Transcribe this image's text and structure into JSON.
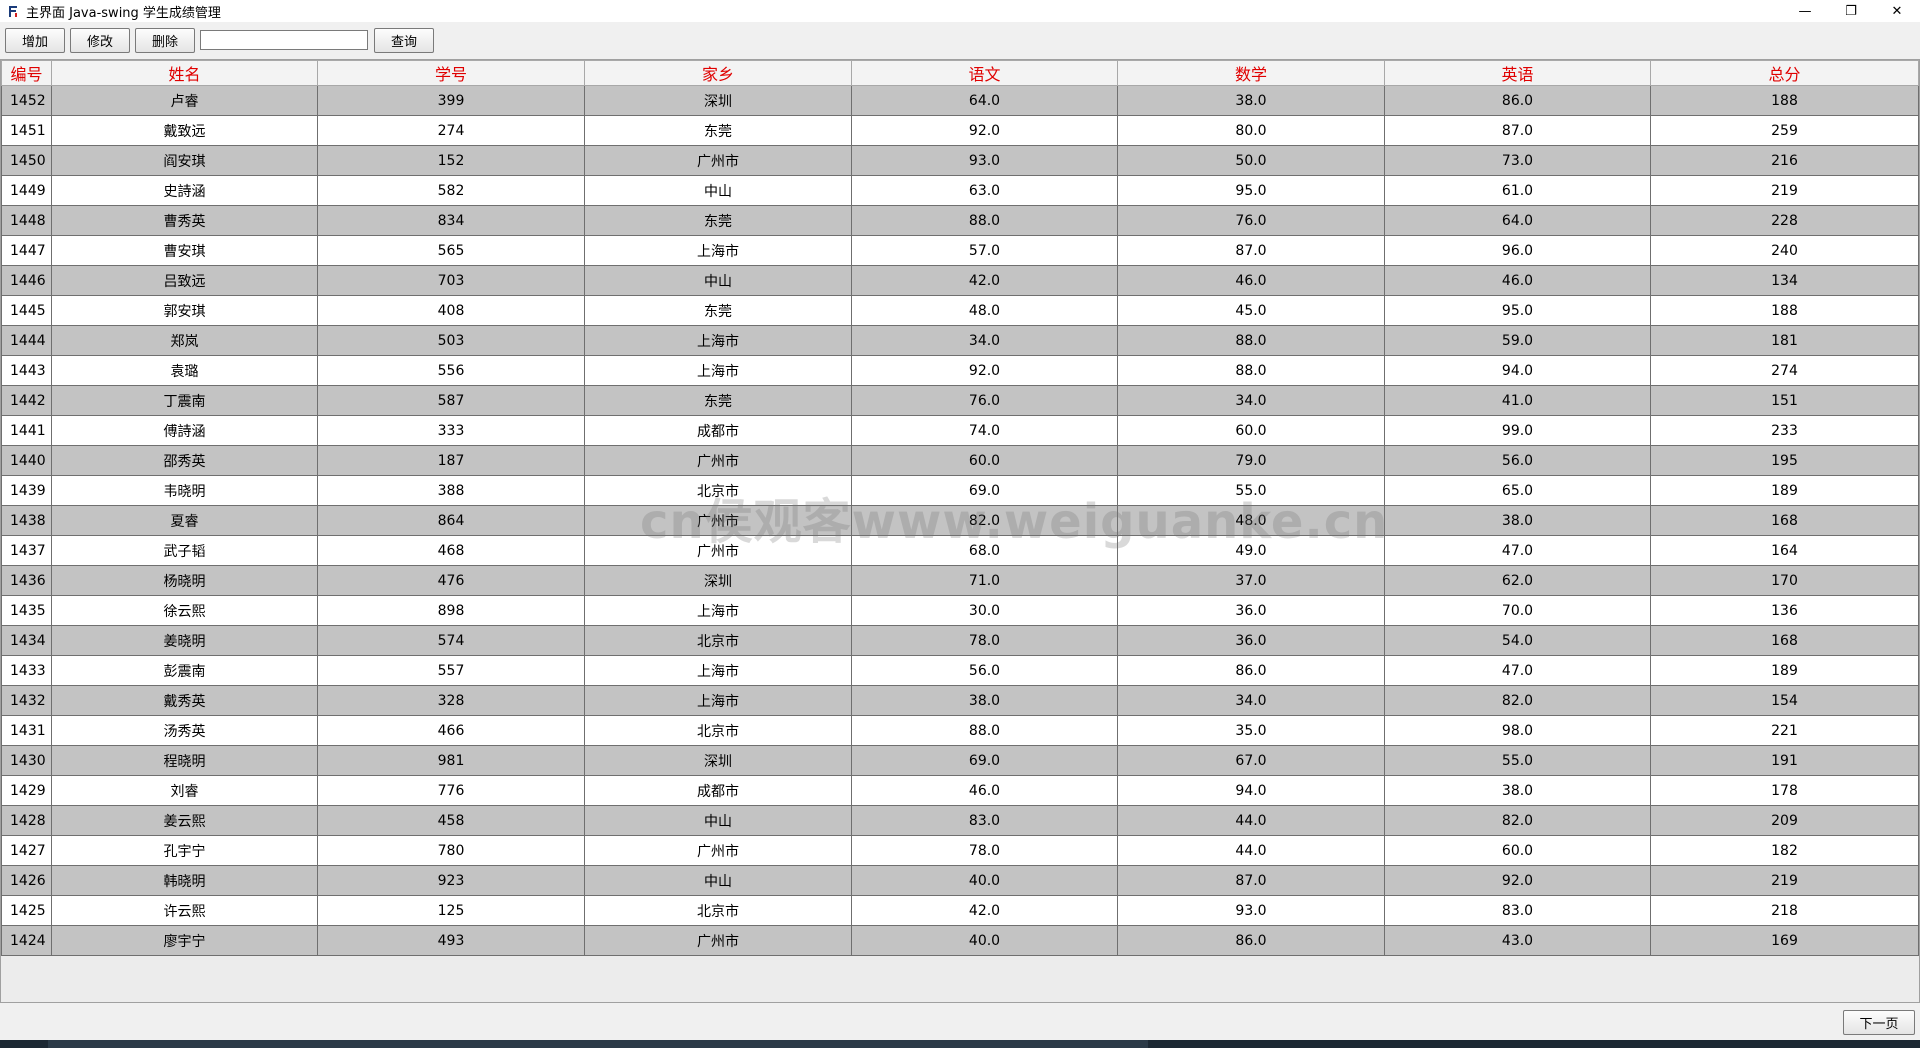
{
  "window": {
    "title": "主界面 Java-swing 学生成绩管理",
    "controls": {
      "minimize_glyph": "—",
      "restore_glyph": "❐",
      "close_glyph": "✕"
    }
  },
  "toolbar": {
    "add_label": "增加",
    "edit_label": "修改",
    "delete_label": "删除",
    "search_value": "",
    "search_placeholder": "",
    "query_label": "查询"
  },
  "table": {
    "columns": [
      "编号",
      "姓名",
      "学号",
      "家乡",
      "语文",
      "数学",
      "英语",
      "总分"
    ],
    "header_color": "#e00000",
    "odd_row_color": "#c3c3c3",
    "even_row_color": "#ffffff",
    "rows": [
      [
        "1452",
        "卢睿",
        "399",
        "深圳",
        "64.0",
        "38.0",
        "86.0",
        "188"
      ],
      [
        "1451",
        "戴致远",
        "274",
        "东莞",
        "92.0",
        "80.0",
        "87.0",
        "259"
      ],
      [
        "1450",
        "阎安琪",
        "152",
        "广州市",
        "93.0",
        "50.0",
        "73.0",
        "216"
      ],
      [
        "1449",
        "史詩涵",
        "582",
        "中山",
        "63.0",
        "95.0",
        "61.0",
        "219"
      ],
      [
        "1448",
        "曹秀英",
        "834",
        "东莞",
        "88.0",
        "76.0",
        "64.0",
        "228"
      ],
      [
        "1447",
        "曹安琪",
        "565",
        "上海市",
        "57.0",
        "87.0",
        "96.0",
        "240"
      ],
      [
        "1446",
        "吕致远",
        "703",
        "中山",
        "42.0",
        "46.0",
        "46.0",
        "134"
      ],
      [
        "1445",
        "郭安琪",
        "408",
        "东莞",
        "48.0",
        "45.0",
        "95.0",
        "188"
      ],
      [
        "1444",
        "郑岚",
        "503",
        "上海市",
        "34.0",
        "88.0",
        "59.0",
        "181"
      ],
      [
        "1443",
        "袁璐",
        "556",
        "上海市",
        "92.0",
        "88.0",
        "94.0",
        "274"
      ],
      [
        "1442",
        "丁震南",
        "587",
        "东莞",
        "76.0",
        "34.0",
        "41.0",
        "151"
      ],
      [
        "1441",
        "傅詩涵",
        "333",
        "成都市",
        "74.0",
        "60.0",
        "99.0",
        "233"
      ],
      [
        "1440",
        "邵秀英",
        "187",
        "广州市",
        "60.0",
        "79.0",
        "56.0",
        "195"
      ],
      [
        "1439",
        "韦晓明",
        "388",
        "北京市",
        "69.0",
        "55.0",
        "65.0",
        "189"
      ],
      [
        "1438",
        "夏睿",
        "864",
        "广州市",
        "82.0",
        "48.0",
        "38.0",
        "168"
      ],
      [
        "1437",
        "武子韬",
        "468",
        "广州市",
        "68.0",
        "49.0",
        "47.0",
        "164"
      ],
      [
        "1436",
        "杨晓明",
        "476",
        "深圳",
        "71.0",
        "37.0",
        "62.0",
        "170"
      ],
      [
        "1435",
        "徐云熙",
        "898",
        "上海市",
        "30.0",
        "36.0",
        "70.0",
        "136"
      ],
      [
        "1434",
        "姜晓明",
        "574",
        "北京市",
        "78.0",
        "36.0",
        "54.0",
        "168"
      ],
      [
        "1433",
        "彭震南",
        "557",
        "上海市",
        "56.0",
        "86.0",
        "47.0",
        "189"
      ],
      [
        "1432",
        "戴秀英",
        "328",
        "上海市",
        "38.0",
        "34.0",
        "82.0",
        "154"
      ],
      [
        "1431",
        "汤秀英",
        "466",
        "北京市",
        "88.0",
        "35.0",
        "98.0",
        "221"
      ],
      [
        "1430",
        "程晓明",
        "981",
        "深圳",
        "69.0",
        "67.0",
        "55.0",
        "191"
      ],
      [
        "1429",
        "刘睿",
        "776",
        "成都市",
        "46.0",
        "94.0",
        "38.0",
        "178"
      ],
      [
        "1428",
        "姜云熙",
        "458",
        "中山",
        "83.0",
        "44.0",
        "82.0",
        "209"
      ],
      [
        "1427",
        "孔宇宁",
        "780",
        "广州市",
        "78.0",
        "44.0",
        "60.0",
        "182"
      ],
      [
        "1426",
        "韩晓明",
        "923",
        "中山",
        "40.0",
        "87.0",
        "92.0",
        "219"
      ],
      [
        "1425",
        "许云熙",
        "125",
        "北京市",
        "42.0",
        "93.0",
        "83.0",
        "218"
      ],
      [
        "1424",
        "廖宇宁",
        "493",
        "广州市",
        "40.0",
        "86.0",
        "43.0",
        "169"
      ]
    ]
  },
  "watermark": "cn侯观客www.weiguanke.cn",
  "pagination": {
    "next_label": "下一页"
  }
}
